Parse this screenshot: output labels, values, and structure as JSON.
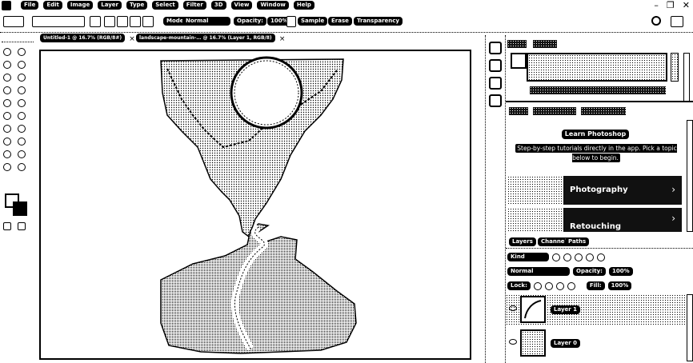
{
  "menubar": {
    "items": [
      "File",
      "Edit",
      "Image",
      "Layer",
      "Type",
      "Select",
      "Filter",
      "3D",
      "View",
      "Window",
      "Help"
    ],
    "controls": {
      "minimize": "–",
      "restore": "❐",
      "close": "✕"
    }
  },
  "options": {
    "mode_label": "Mode:",
    "mode_value": "Normal",
    "opacity_label": "Opacity:",
    "opacity_value": "100%",
    "buttons": [
      "Sample",
      "Erase",
      "Transparency"
    ]
  },
  "tabs": [
    {
      "label": "Untitled-1 @ 16.7% (RGB/8#)",
      "close": "×"
    },
    {
      "label": "landscape-mountain-… @ 16.7% (Layer 1, RGB/8)",
      "close": "×"
    }
  ],
  "learn": {
    "title": "Learn Photoshop",
    "description": "Step-by-step tutorials directly in the app. Pick a topic below to begin.",
    "topics": [
      {
        "label": "Photography",
        "chevron": "›"
      },
      {
        "label": "Retouching",
        "chevron": "›"
      }
    ]
  },
  "layers": {
    "tabs": [
      "Layers",
      "Channels",
      "Paths"
    ],
    "kind_label": "Kind",
    "blend_mode": "Normal",
    "opacity_label": "Opacity:",
    "opacity_value": "100%",
    "lock_label": "Lock:",
    "fill_label": "Fill:",
    "fill_value": "100%",
    "rows": [
      {
        "name": "Layer 1"
      },
      {
        "name": "Layer 0"
      }
    ]
  },
  "icons": {
    "ps": "photoshop-app-icon",
    "search": "search-icon",
    "workspace": "workspace-icon"
  }
}
